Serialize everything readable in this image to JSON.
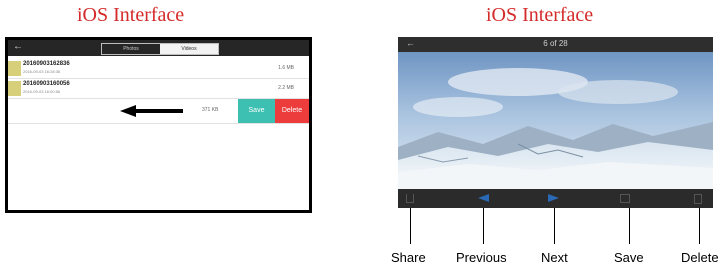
{
  "captions": {
    "left": "iOS Interface",
    "right": "iOS Interface"
  },
  "left_phone": {
    "back_icon": "back-arrow-icon",
    "tabs": [
      {
        "label": "Photos",
        "selected": false
      },
      {
        "label": "Videos",
        "selected": true
      }
    ],
    "files": [
      {
        "name": "20160903162836",
        "date": "2016-09-03 16:28:36",
        "size": "1.6 MB"
      },
      {
        "name": "20160903160056",
        "date": "2016-09-03 16:00:56",
        "size": "2.2 MB"
      }
    ],
    "swipe_row": {
      "size": "371 KB",
      "save_label": "Save",
      "delete_label": "Delete"
    },
    "colors": {
      "save": "#3dbfb2",
      "delete": "#ec3c3c"
    }
  },
  "right_phone": {
    "back_icon": "back-arrow-icon",
    "title": "6 of 28",
    "toolbar_icons": [
      "share-icon",
      "previous-icon",
      "next-icon",
      "save-icon",
      "delete-icon"
    ]
  },
  "labels": [
    "Share",
    "Previous",
    "Next",
    "Save",
    "Delete"
  ]
}
